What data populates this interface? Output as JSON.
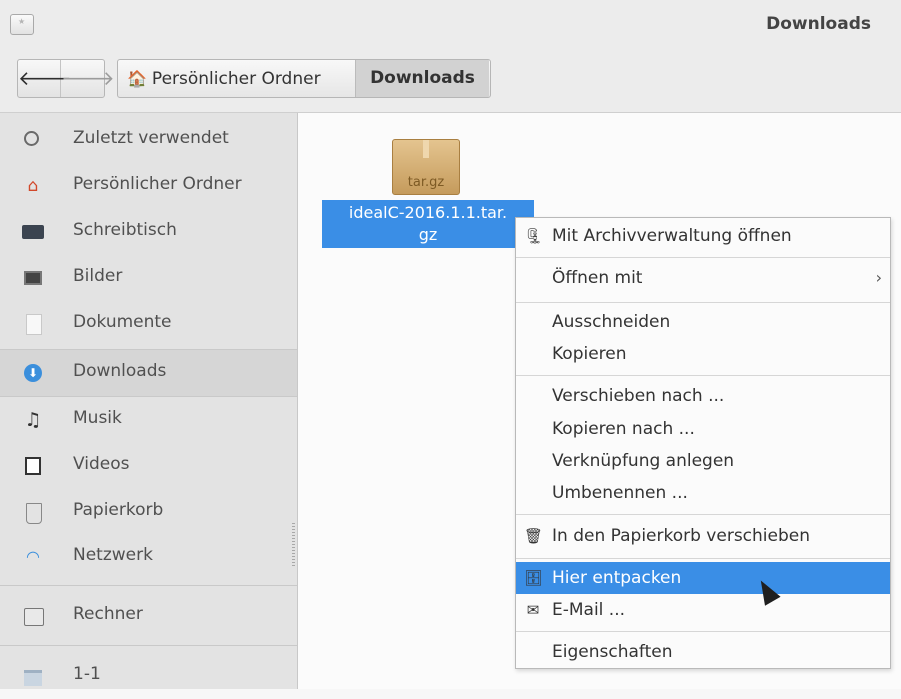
{
  "window": {
    "title": "Downloads"
  },
  "toolbar": {
    "back_icon": "arrow-left-icon",
    "forward_icon": "arrow-right-icon",
    "path": [
      {
        "label": "Persönlicher Ordner",
        "icon": "home-icon"
      },
      {
        "label": "Downloads",
        "active": true
      }
    ]
  },
  "sidebar": {
    "items": [
      {
        "label": "Zuletzt verwendet",
        "icon": "clock-icon"
      },
      {
        "label": "Persönlicher Ordner",
        "icon": "home-icon"
      },
      {
        "label": "Schreibtisch",
        "icon": "desktop-icon"
      },
      {
        "label": "Bilder",
        "icon": "pictures-icon"
      },
      {
        "label": "Dokumente",
        "icon": "document-icon"
      },
      {
        "label": "Downloads",
        "icon": "download-icon",
        "selected": true
      },
      {
        "label": "Musik",
        "icon": "music-icon"
      },
      {
        "label": "Videos",
        "icon": "video-icon"
      },
      {
        "label": "Papierkorb",
        "icon": "trash-icon"
      },
      {
        "label": "Netzwerk",
        "icon": "network-icon"
      },
      {
        "label": "Rechner",
        "icon": "computer-icon"
      },
      {
        "label": "1-1",
        "icon": "folder-icon"
      }
    ]
  },
  "files": [
    {
      "name_line1": "idealC-2016.1.1.tar.",
      "name_line2": "gz",
      "icon_label": "tar.gz",
      "icon": "archive-icon",
      "selected": true
    }
  ],
  "context_menu": {
    "items": [
      {
        "label": "Mit Archivverwaltung öffnen",
        "icon": "archive-manager-icon"
      },
      {
        "label": "Öffnen mit",
        "submenu": true
      },
      {
        "label": "Ausschneiden"
      },
      {
        "label": "Kopieren"
      },
      {
        "label": "Verschieben nach ..."
      },
      {
        "label": "Kopieren nach ..."
      },
      {
        "label": "Verknüpfung anlegen"
      },
      {
        "label": "Umbenennen ..."
      },
      {
        "label": "In den Papierkorb verschieben",
        "icon": "trash-icon"
      },
      {
        "label": "Hier entpacken",
        "icon": "extract-icon",
        "highlighted": true
      },
      {
        "label": "E-Mail ...",
        "icon": "email-icon"
      },
      {
        "label": "Eigenschaften"
      }
    ]
  },
  "colors": {
    "selection": "#3a8ee6",
    "sidebar_bg": "#e3e3e3"
  }
}
